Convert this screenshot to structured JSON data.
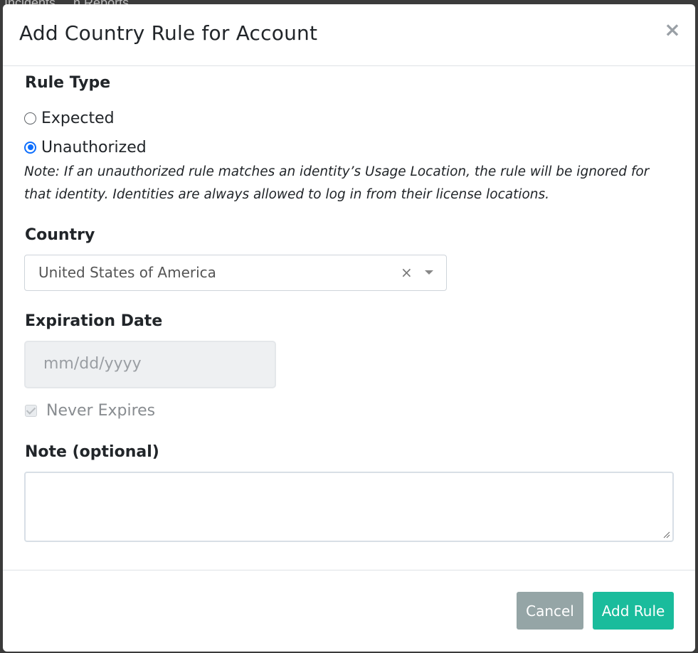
{
  "background": {
    "text": "Incidents ... n  Reports  ...",
    "color": "#3b3b3b"
  },
  "modal": {
    "title": "Add Country Rule for Account",
    "close_icon": "close-icon"
  },
  "rule_type": {
    "label": "Rule Type",
    "options": [
      {
        "label": "Expected",
        "checked": false
      },
      {
        "label": "Unauthorized",
        "checked": true
      }
    ],
    "note": "Note: If an unauthorized rule matches an identity’s Usage Location, the rule will be ignored for that identity. Identities are always allowed to log in from their license locations."
  },
  "country": {
    "label": "Country",
    "selected_value": "United States of America",
    "clear_glyph": "×"
  },
  "expiration": {
    "label": "Expiration Date",
    "placeholder": "mm/dd/yyyy",
    "never_expires_label": "Never Expires",
    "never_expires_checked": true
  },
  "note_field": {
    "label": "Note (optional)",
    "value": ""
  },
  "footer": {
    "cancel_label": "Cancel",
    "add_label": "Add Rule"
  },
  "colors": {
    "primary": "#0d6efd",
    "cancel_button": "#95a5a6",
    "add_button": "#1abc9c"
  }
}
